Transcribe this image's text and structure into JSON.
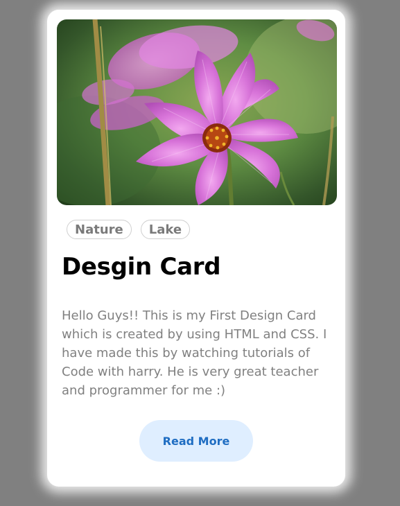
{
  "card": {
    "tags": [
      "Nature",
      "Lake"
    ],
    "title": "Desgin Card",
    "description": "Hello Guys!! This is my First Design Card which is created by using HTML and CSS. I have made this by watching tutorials of Code with harry. He is very great teacher and programmer for me :)",
    "button_label": "Read More"
  },
  "colors": {
    "page_background": "#808080",
    "card_background": "#ffffff",
    "button_background": "#dfeeff",
    "button_text": "#1f6dc2",
    "tag_text": "#7a7a7a",
    "flower_petal": "#d46fd8"
  }
}
